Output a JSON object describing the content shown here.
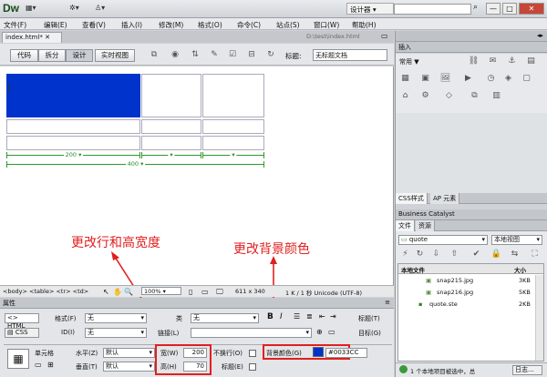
{
  "app": {
    "logo": "Dw",
    "workspace": "设计器",
    "window_controls": [
      "—",
      "□",
      "✕"
    ]
  },
  "menu": [
    "文件(F)",
    "编辑(E)",
    "查看(V)",
    "插入(I)",
    "修改(M)",
    "格式(O)",
    "命令(C)",
    "站点(S)",
    "窗口(W)",
    "帮助(H)"
  ],
  "document": {
    "tab": "index.html*",
    "path": "D:\\test\\index.html"
  },
  "view_buttons": [
    "代码",
    "拆分",
    "设计",
    "实时视图"
  ],
  "title_label": "标题:",
  "title_value": "无标题文档",
  "canvas": {
    "cell_color": "#0033CC",
    "width_200": "200 ▾",
    "width_400": "400 ▾",
    "annotation_left": "更改行和高宽度",
    "annotation_right": "更改背景颜色"
  },
  "statusbar": {
    "tags": "<body> <table> <tr> <td>",
    "zoom": "100%",
    "size": "611 x 340",
    "info": "1 K / 1 秒  Unicode (UTF-8)"
  },
  "properties": {
    "header": "属性",
    "html_btn": "<> HTML",
    "css_btn": "CSS",
    "format_label": "格式(F)",
    "format_value": "无",
    "id_label": "ID(I)",
    "id_value": "无",
    "class_label": "类",
    "class_value": "无",
    "link_label": "链接(L)",
    "title_label": "标题(T)",
    "target_label": "目标(G)",
    "bold": "B",
    "italic": "I",
    "cell_label": "单元格",
    "horz_label": "水平(Z)",
    "horz_value": "默认",
    "vert_label": "垂直(T)",
    "vert_value": "默认",
    "width_label": "宽(W)",
    "width_value": "200",
    "height_label": "高(H)",
    "height_value": "70",
    "nowrap_label": "不换行(O)",
    "header_label": "标题(E)",
    "bg_label": "背景颜色(G)",
    "bg_value": "#0033CC",
    "page_props": "页面属性...",
    "bg_color": "#0033CC"
  },
  "right": {
    "insert_header": "插入",
    "common": "常用 ▼",
    "css_tab": "CSS样式",
    "ap_tab": "AP 元素",
    "bc_header": "Business Catalyst",
    "files_tab": "文件",
    "assets_tab": "资源",
    "site_select": "quote",
    "view_select": "本地视图",
    "local_files": "本地文件",
    "size_col": "大小",
    "files": [
      {
        "name": "snap215.jpg",
        "size": "3KB"
      },
      {
        "name": "snap216.jpg",
        "size": "5KB"
      },
      {
        "name": "quote.ste",
        "size": "2KB"
      }
    ],
    "status": "1 个本地项目被选中，总",
    "log_button": "日志..."
  }
}
